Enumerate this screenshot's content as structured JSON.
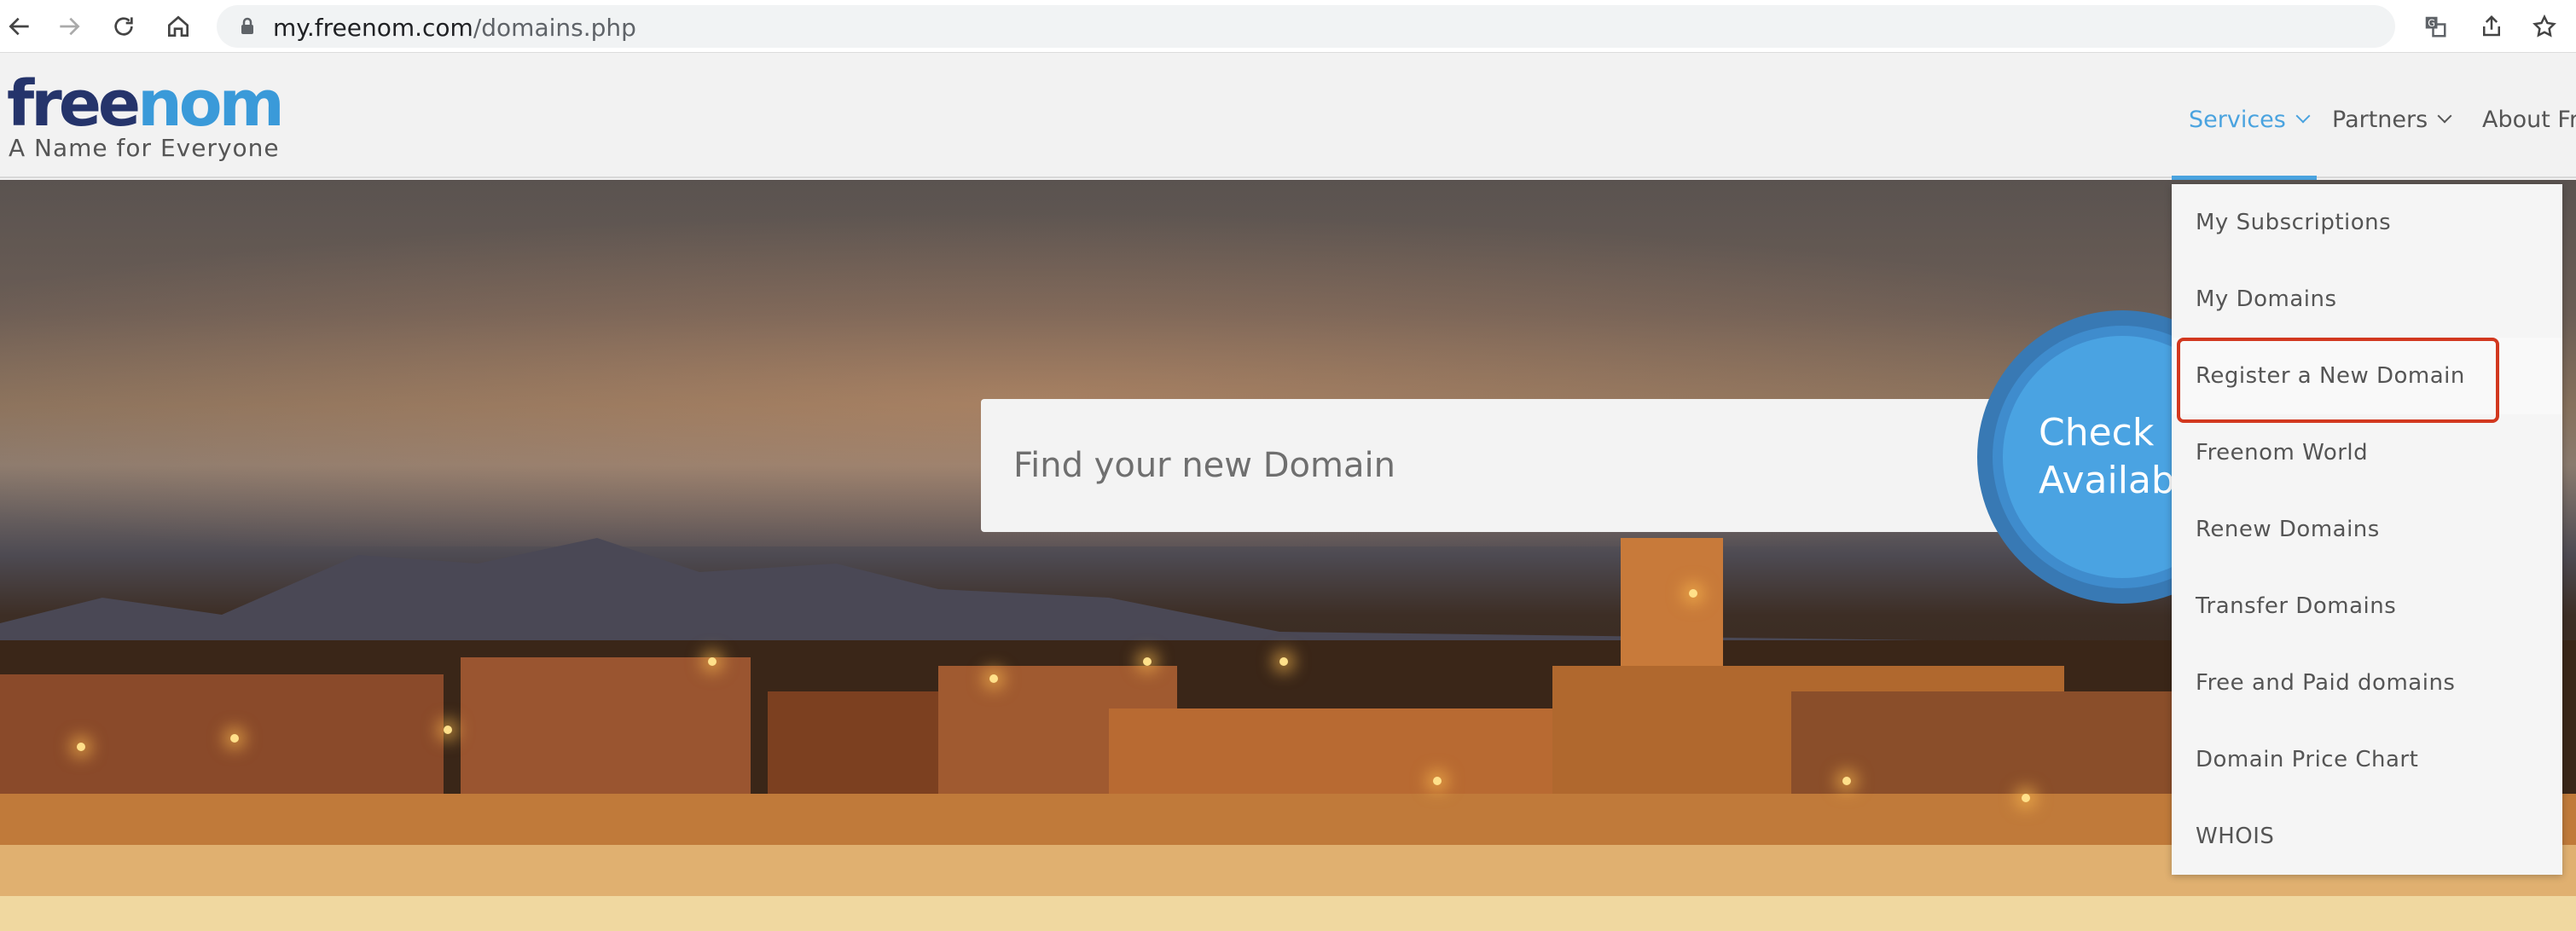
{
  "browser": {
    "url_host": "my.freenom.com",
    "url_path": "/domains.php",
    "icons": [
      "back-icon",
      "forward-icon",
      "reload-icon",
      "home-icon",
      "lock-icon",
      "translate-icon",
      "share-icon",
      "bookmark-star-icon"
    ]
  },
  "header": {
    "logo_part1": "free",
    "logo_part2": "nom",
    "tagline": "A Name for Everyone",
    "nav": {
      "services": "Services",
      "partners": "Partners",
      "about": "About Fr"
    },
    "accent_color": "#4aa3df"
  },
  "hero": {
    "search_placeholder": "Find your new Domain",
    "check_line1": "Check",
    "check_line2": "Availabili"
  },
  "dropdown": {
    "items": [
      {
        "label": "My Subscriptions"
      },
      {
        "label": "My Domains"
      },
      {
        "label": "Register a New Domain"
      },
      {
        "label": "Freenom World"
      },
      {
        "label": "Renew Domains"
      },
      {
        "label": "Transfer Domains"
      },
      {
        "label": "Free and Paid domains"
      },
      {
        "label": "Domain Price Chart"
      },
      {
        "label": "WHOIS"
      }
    ],
    "highlight_color": "#d2381f"
  }
}
